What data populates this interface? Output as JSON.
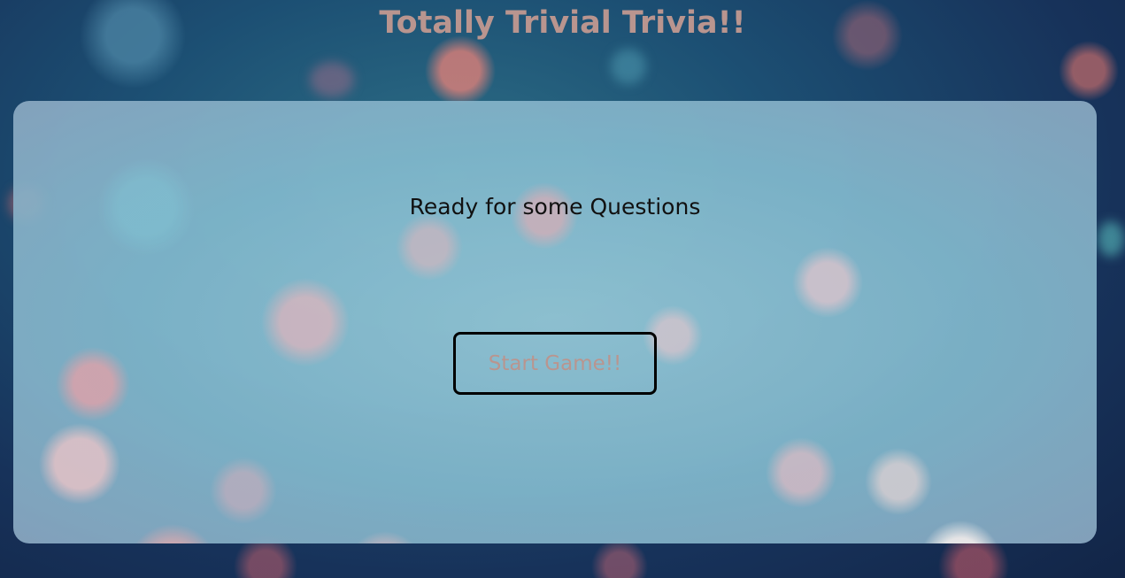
{
  "header": {
    "title": "Totally Trivial Trivia!!"
  },
  "card": {
    "prompt": "Ready for some Questions",
    "start_button_label": "Start Game!!"
  },
  "colors": {
    "title_text": "#b9958f",
    "button_text": "#b9958f",
    "button_border": "#000000",
    "prompt_text": "#111111",
    "background_dark": "#17325a",
    "card_tint": "#9cc9d8"
  }
}
